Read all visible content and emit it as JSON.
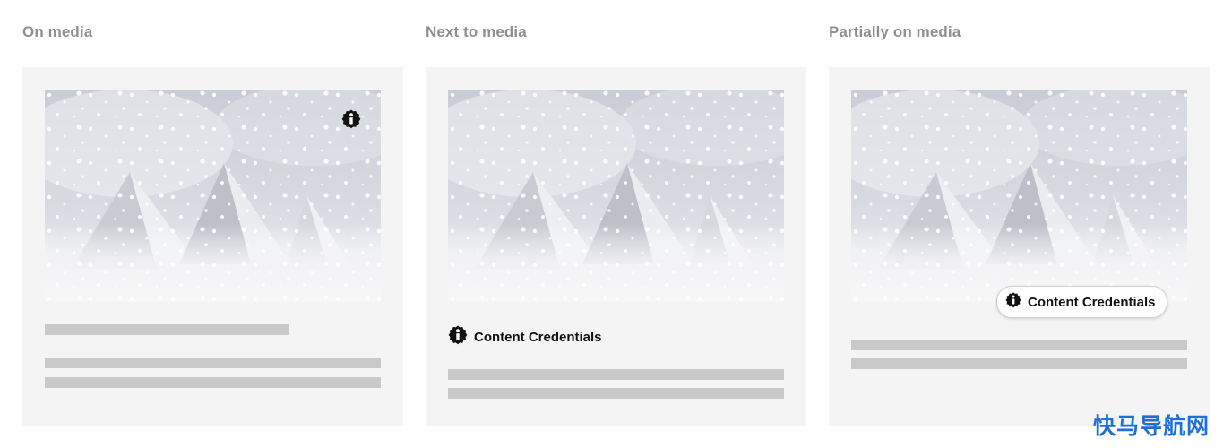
{
  "columns": [
    {
      "title": "On media"
    },
    {
      "title": "Next to media",
      "credential_label": "Content Credentials"
    },
    {
      "title": "Partially on media",
      "credential_label": "Content Credentials"
    }
  ],
  "icons": {
    "credential": "info-badge-icon"
  },
  "colors": {
    "heading": "#8f8f8f",
    "card_bg": "#f4f4f4",
    "placeholder_bar": "#c9c9c9",
    "badge": "#111111",
    "watermark": "#1e6fd9"
  },
  "watermark": "快马导航网"
}
